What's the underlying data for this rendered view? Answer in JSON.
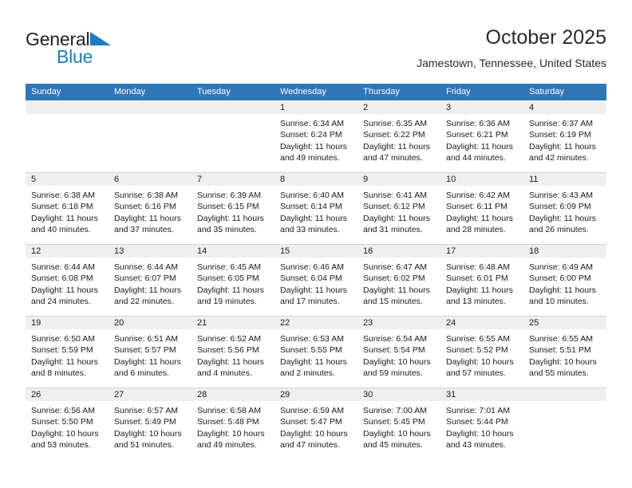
{
  "brand": {
    "name_part1": "General",
    "name_part2": "Blue",
    "triangle_color": "#1b7cc2"
  },
  "header": {
    "title": "October 2025",
    "subtitle": "Jamestown, Tennessee, United States",
    "header_bg": "#2e76b8",
    "header_text_color": "#ffffff"
  },
  "weekdays": [
    "Sunday",
    "Monday",
    "Tuesday",
    "Wednesday",
    "Thursday",
    "Friday",
    "Saturday"
  ],
  "weeks": [
    [
      {
        "day": "",
        "sunrise": "",
        "sunset": "",
        "daylight_line1": "",
        "daylight_line2": ""
      },
      {
        "day": "",
        "sunrise": "",
        "sunset": "",
        "daylight_line1": "",
        "daylight_line2": ""
      },
      {
        "day": "",
        "sunrise": "",
        "sunset": "",
        "daylight_line1": "",
        "daylight_line2": ""
      },
      {
        "day": "1",
        "sunrise": "Sunrise: 6:34 AM",
        "sunset": "Sunset: 6:24 PM",
        "daylight_line1": "Daylight: 11 hours",
        "daylight_line2": "and 49 minutes."
      },
      {
        "day": "2",
        "sunrise": "Sunrise: 6:35 AM",
        "sunset": "Sunset: 6:22 PM",
        "daylight_line1": "Daylight: 11 hours",
        "daylight_line2": "and 47 minutes."
      },
      {
        "day": "3",
        "sunrise": "Sunrise: 6:36 AM",
        "sunset": "Sunset: 6:21 PM",
        "daylight_line1": "Daylight: 11 hours",
        "daylight_line2": "and 44 minutes."
      },
      {
        "day": "4",
        "sunrise": "Sunrise: 6:37 AM",
        "sunset": "Sunset: 6:19 PM",
        "daylight_line1": "Daylight: 11 hours",
        "daylight_line2": "and 42 minutes."
      }
    ],
    [
      {
        "day": "5",
        "sunrise": "Sunrise: 6:38 AM",
        "sunset": "Sunset: 6:18 PM",
        "daylight_line1": "Daylight: 11 hours",
        "daylight_line2": "and 40 minutes."
      },
      {
        "day": "6",
        "sunrise": "Sunrise: 6:38 AM",
        "sunset": "Sunset: 6:16 PM",
        "daylight_line1": "Daylight: 11 hours",
        "daylight_line2": "and 37 minutes."
      },
      {
        "day": "7",
        "sunrise": "Sunrise: 6:39 AM",
        "sunset": "Sunset: 6:15 PM",
        "daylight_line1": "Daylight: 11 hours",
        "daylight_line2": "and 35 minutes."
      },
      {
        "day": "8",
        "sunrise": "Sunrise: 6:40 AM",
        "sunset": "Sunset: 6:14 PM",
        "daylight_line1": "Daylight: 11 hours",
        "daylight_line2": "and 33 minutes."
      },
      {
        "day": "9",
        "sunrise": "Sunrise: 6:41 AM",
        "sunset": "Sunset: 6:12 PM",
        "daylight_line1": "Daylight: 11 hours",
        "daylight_line2": "and 31 minutes."
      },
      {
        "day": "10",
        "sunrise": "Sunrise: 6:42 AM",
        "sunset": "Sunset: 6:11 PM",
        "daylight_line1": "Daylight: 11 hours",
        "daylight_line2": "and 28 minutes."
      },
      {
        "day": "11",
        "sunrise": "Sunrise: 6:43 AM",
        "sunset": "Sunset: 6:09 PM",
        "daylight_line1": "Daylight: 11 hours",
        "daylight_line2": "and 26 minutes."
      }
    ],
    [
      {
        "day": "12",
        "sunrise": "Sunrise: 6:44 AM",
        "sunset": "Sunset: 6:08 PM",
        "daylight_line1": "Daylight: 11 hours",
        "daylight_line2": "and 24 minutes."
      },
      {
        "day": "13",
        "sunrise": "Sunrise: 6:44 AM",
        "sunset": "Sunset: 6:07 PM",
        "daylight_line1": "Daylight: 11 hours",
        "daylight_line2": "and 22 minutes."
      },
      {
        "day": "14",
        "sunrise": "Sunrise: 6:45 AM",
        "sunset": "Sunset: 6:05 PM",
        "daylight_line1": "Daylight: 11 hours",
        "daylight_line2": "and 19 minutes."
      },
      {
        "day": "15",
        "sunrise": "Sunrise: 6:46 AM",
        "sunset": "Sunset: 6:04 PM",
        "daylight_line1": "Daylight: 11 hours",
        "daylight_line2": "and 17 minutes."
      },
      {
        "day": "16",
        "sunrise": "Sunrise: 6:47 AM",
        "sunset": "Sunset: 6:02 PM",
        "daylight_line1": "Daylight: 11 hours",
        "daylight_line2": "and 15 minutes."
      },
      {
        "day": "17",
        "sunrise": "Sunrise: 6:48 AM",
        "sunset": "Sunset: 6:01 PM",
        "daylight_line1": "Daylight: 11 hours",
        "daylight_line2": "and 13 minutes."
      },
      {
        "day": "18",
        "sunrise": "Sunrise: 6:49 AM",
        "sunset": "Sunset: 6:00 PM",
        "daylight_line1": "Daylight: 11 hours",
        "daylight_line2": "and 10 minutes."
      }
    ],
    [
      {
        "day": "19",
        "sunrise": "Sunrise: 6:50 AM",
        "sunset": "Sunset: 5:59 PM",
        "daylight_line1": "Daylight: 11 hours",
        "daylight_line2": "and 8 minutes."
      },
      {
        "day": "20",
        "sunrise": "Sunrise: 6:51 AM",
        "sunset": "Sunset: 5:57 PM",
        "daylight_line1": "Daylight: 11 hours",
        "daylight_line2": "and 6 minutes."
      },
      {
        "day": "21",
        "sunrise": "Sunrise: 6:52 AM",
        "sunset": "Sunset: 5:56 PM",
        "daylight_line1": "Daylight: 11 hours",
        "daylight_line2": "and 4 minutes."
      },
      {
        "day": "22",
        "sunrise": "Sunrise: 6:53 AM",
        "sunset": "Sunset: 5:55 PM",
        "daylight_line1": "Daylight: 11 hours",
        "daylight_line2": "and 2 minutes."
      },
      {
        "day": "23",
        "sunrise": "Sunrise: 6:54 AM",
        "sunset": "Sunset: 5:54 PM",
        "daylight_line1": "Daylight: 10 hours",
        "daylight_line2": "and 59 minutes."
      },
      {
        "day": "24",
        "sunrise": "Sunrise: 6:55 AM",
        "sunset": "Sunset: 5:52 PM",
        "daylight_line1": "Daylight: 10 hours",
        "daylight_line2": "and 57 minutes."
      },
      {
        "day": "25",
        "sunrise": "Sunrise: 6:55 AM",
        "sunset": "Sunset: 5:51 PM",
        "daylight_line1": "Daylight: 10 hours",
        "daylight_line2": "and 55 minutes."
      }
    ],
    [
      {
        "day": "26",
        "sunrise": "Sunrise: 6:56 AM",
        "sunset": "Sunset: 5:50 PM",
        "daylight_line1": "Daylight: 10 hours",
        "daylight_line2": "and 53 minutes."
      },
      {
        "day": "27",
        "sunrise": "Sunrise: 6:57 AM",
        "sunset": "Sunset: 5:49 PM",
        "daylight_line1": "Daylight: 10 hours",
        "daylight_line2": "and 51 minutes."
      },
      {
        "day": "28",
        "sunrise": "Sunrise: 6:58 AM",
        "sunset": "Sunset: 5:48 PM",
        "daylight_line1": "Daylight: 10 hours",
        "daylight_line2": "and 49 minutes."
      },
      {
        "day": "29",
        "sunrise": "Sunrise: 6:59 AM",
        "sunset": "Sunset: 5:47 PM",
        "daylight_line1": "Daylight: 10 hours",
        "daylight_line2": "and 47 minutes."
      },
      {
        "day": "30",
        "sunrise": "Sunrise: 7:00 AM",
        "sunset": "Sunset: 5:45 PM",
        "daylight_line1": "Daylight: 10 hours",
        "daylight_line2": "and 45 minutes."
      },
      {
        "day": "31",
        "sunrise": "Sunrise: 7:01 AM",
        "sunset": "Sunset: 5:44 PM",
        "daylight_line1": "Daylight: 10 hours",
        "daylight_line2": "and 43 minutes."
      },
      {
        "day": "",
        "sunrise": "",
        "sunset": "",
        "daylight_line1": "",
        "daylight_line2": ""
      }
    ]
  ]
}
